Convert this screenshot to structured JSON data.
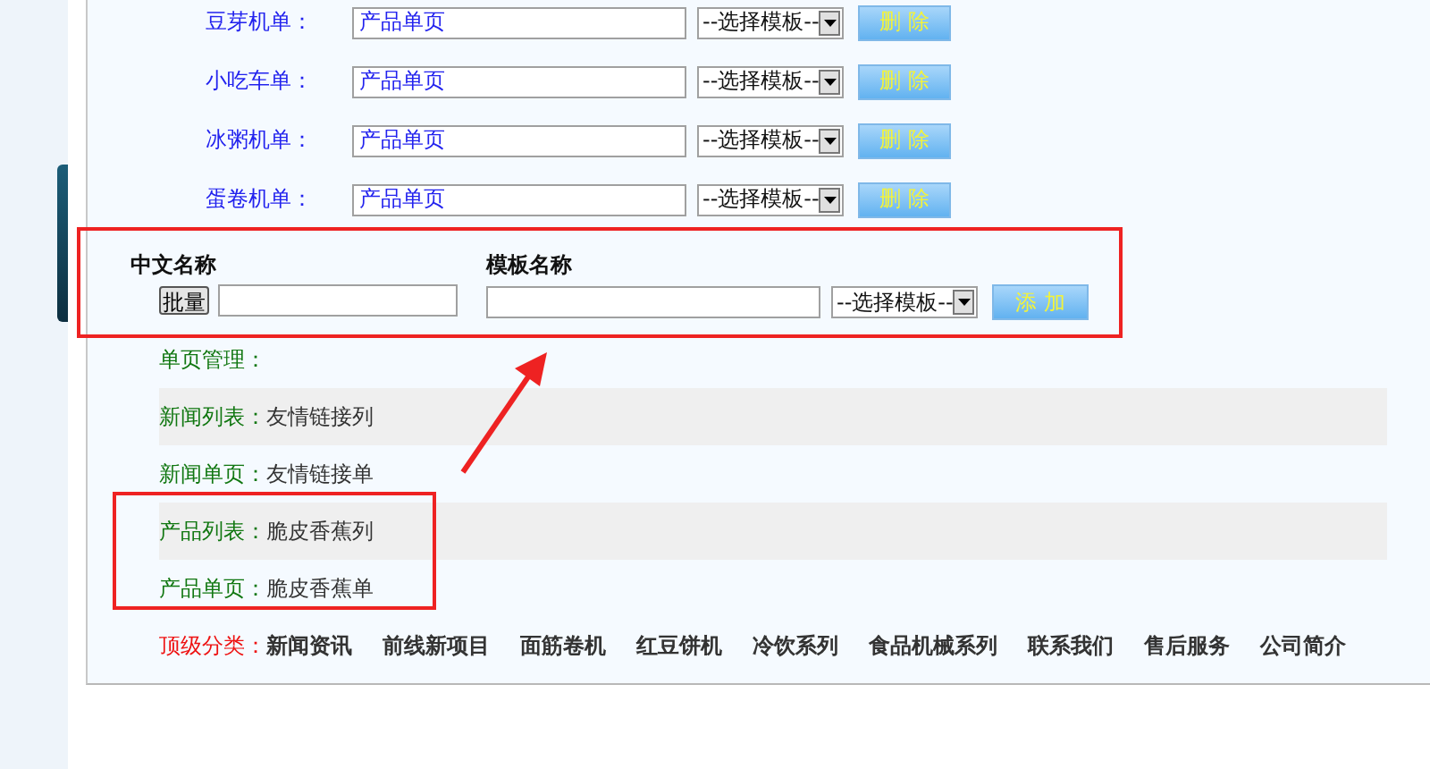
{
  "page_rows": [
    {
      "label": "豆芽机单：",
      "value": "产品单页",
      "template": "--选择模板--",
      "button": "删 除"
    },
    {
      "label": "小吃车单：",
      "value": "产品单页",
      "template": "--选择模板--",
      "button": "删 除"
    },
    {
      "label": "冰粥机单：",
      "value": "产品单页",
      "template": "--选择模板--",
      "button": "删 除"
    },
    {
      "label": "蛋卷机单：",
      "value": "产品单页",
      "template": "--选择模板--",
      "button": "删 除"
    }
  ],
  "add_form": {
    "name_header": "中文名称",
    "batch_button": "批量",
    "template_header": "模板名称",
    "template_select": "--选择模板--",
    "add_button": "添 加"
  },
  "single_page": {
    "label": "单页管理："
  },
  "templates": [
    {
      "label": "新闻列表：",
      "value": "友情链接列"
    },
    {
      "label": "新闻单页：",
      "value": "友情链接单"
    },
    {
      "label": "产品列表：",
      "value": "脆皮香蕉列"
    },
    {
      "label": "产品单页：",
      "value": "脆皮香蕉单"
    }
  ],
  "top_categories": {
    "label": "顶级分类：",
    "items": [
      "新闻资讯",
      "前线新项目",
      "面筋卷机",
      "红豆饼机",
      "冷饮系列",
      "食品机械系列",
      "联系我们",
      "售后服务",
      "公司简介"
    ]
  }
}
